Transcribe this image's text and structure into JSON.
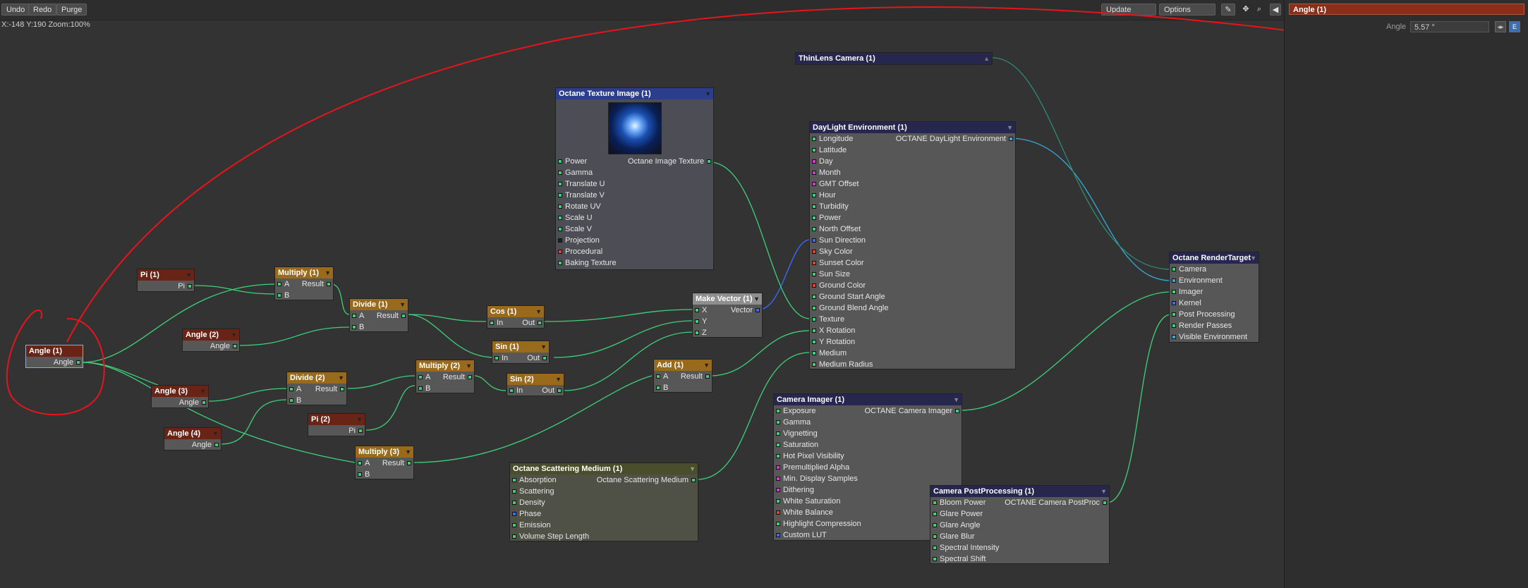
{
  "toolbar": {
    "undo": "Undo",
    "redo": "Redo",
    "purge": "Purge",
    "update": "Update",
    "options": "Options"
  },
  "status": "X:-148 Y:190 Zoom:100%",
  "panel": {
    "title": "Angle (1)",
    "label": "Angle",
    "value": "5.57 °",
    "e_button": "E"
  },
  "colors": {
    "green": "#3dd17a",
    "blue": "#3a6cff",
    "cyan": "#35a9d9",
    "magenta": "#d43ad4",
    "red": "#d54a2a",
    "annotation": "#e8141c"
  },
  "nodes": {
    "angle1": {
      "title": "Angle (1)",
      "out": [
        "Angle"
      ]
    },
    "pi1": {
      "title": "Pi (1)",
      "out": [
        "Pi"
      ]
    },
    "multiply1": {
      "title": "Multiply (1)",
      "in": [
        "A",
        "B"
      ],
      "out": "Result"
    },
    "angle2": {
      "title": "Angle (2)",
      "out": [
        "Angle"
      ]
    },
    "divide1": {
      "title": "Divide (1)",
      "in": [
        "A",
        "B"
      ],
      "out": "Result"
    },
    "angle3": {
      "title": "Angle (3)",
      "out": [
        "Angle"
      ]
    },
    "angle4": {
      "title": "Angle (4)",
      "out": [
        "Angle"
      ]
    },
    "divide2": {
      "title": "Divide (2)",
      "in": [
        "A",
        "B"
      ],
      "out": "Result"
    },
    "pi2": {
      "title": "Pi (2)",
      "out": [
        "Pi"
      ]
    },
    "multiply2": {
      "title": "Multiply (2)",
      "in": [
        "A",
        "B"
      ],
      "out": "Result"
    },
    "multiply3": {
      "title": "Multiply (3)",
      "in": [
        "A",
        "B"
      ],
      "out": "Result"
    },
    "cos1": {
      "title": "Cos (1)",
      "in": [
        "In"
      ],
      "out": "Out"
    },
    "sin1": {
      "title": "Sin (1)",
      "in": [
        "In"
      ],
      "out": "Out"
    },
    "sin2": {
      "title": "Sin (2)",
      "in": [
        "In"
      ],
      "out": "Out"
    },
    "add1": {
      "title": "Add (1)",
      "in": [
        "A",
        "B"
      ],
      "out": "Result"
    },
    "makevector": {
      "title": "Make Vector (1)",
      "in": [
        "X",
        "Y",
        "Z"
      ],
      "out": "Vector"
    },
    "octanetex": {
      "title": "Octane Texture Image (1)",
      "out": "Octane Image Texture",
      "in": [
        "Power",
        "Gamma",
        "Translate U",
        "Translate V",
        "Rotate UV",
        "Scale U",
        "Scale V",
        "Projection",
        "Procedural",
        "Baking Texture"
      ]
    },
    "thinlens": {
      "title": "ThinLens Camera (1)"
    },
    "daylight": {
      "title": "DayLight Environment (1)",
      "out": "OCTANE DayLight Environment",
      "in": [
        "Longitude",
        "Latitude",
        "Day",
        "Month",
        "GMT Offset",
        "Hour",
        "Turbidity",
        "Power",
        "North Offset",
        "Sun Direction",
        "Sky Color",
        "Sunset Color",
        "Sun Size",
        "Ground Color",
        "Ground Start Angle",
        "Ground Blend Angle",
        "Texture",
        "X Rotation",
        "Y Rotation",
        "Medium",
        "Medium Radius"
      ]
    },
    "rendertarget": {
      "title": "Octane RenderTarget",
      "in": [
        "Camera",
        "Environment",
        "Imager",
        "Kernel",
        "Post Processing",
        "Render Passes",
        "Visible Environment"
      ]
    },
    "camimager": {
      "title": "Camera Imager (1)",
      "out": "OCTANE Camera Imager",
      "in": [
        "Exposure",
        "Gamma",
        "Vignetting",
        "Saturation",
        "Hot Pixel Visibility",
        "Premultiplied Alpha",
        "Min. Display Samples",
        "Dithering",
        "White Saturation",
        "White Balance",
        "Highlight Compression",
        "Custom LUT"
      ]
    },
    "campost": {
      "title": "Camera PostProcessing (1)",
      "out": "OCTANE Camera PostProc",
      "in": [
        "Bloom Power",
        "Glare Power",
        "Glare Angle",
        "Glare Blur",
        "Spectral Intensity",
        "Spectral Shift"
      ]
    },
    "scatter": {
      "title": "Octane Scattering Medium (1)",
      "out": "Octane Scattering Medium",
      "in": [
        "Absorption",
        "Scattering",
        "Density",
        "Phase",
        "Emission",
        "Volume Step Length"
      ]
    }
  }
}
